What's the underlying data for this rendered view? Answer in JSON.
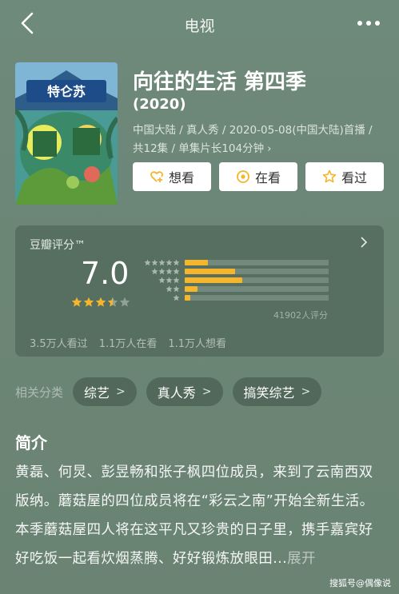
{
  "header": {
    "title": "电视"
  },
  "show": {
    "title": "向往的生活 第四季",
    "year": "(2020)",
    "meta": "中国大陆 / 真人秀 / 2020-05-08(中国大陆)首播 / 共12集 / 单集片长104分钟",
    "meta_chevron": "›",
    "poster_text": "特仑苏"
  },
  "actions": {
    "want": "想看",
    "watching": "在看",
    "watched": "看过"
  },
  "rating": {
    "label": "豆瓣评分™",
    "score": "7.0",
    "stars_value": 3.5,
    "distribution": [
      {
        "stars": 5,
        "fraction": 0.16
      },
      {
        "stars": 4,
        "fraction": 0.35
      },
      {
        "stars": 3,
        "fraction": 0.4
      },
      {
        "stars": 2,
        "fraction": 0.09
      },
      {
        "stars": 1,
        "fraction": 0.04
      }
    ],
    "count": "41902人评分",
    "stats": [
      "3.5万人看过",
      "1.1万人在看",
      "1.1万人想看"
    ],
    "star_color": "#f5b62b"
  },
  "categories": {
    "label": "相关分类",
    "tags": [
      "综艺",
      "真人秀",
      "搞笑综艺"
    ]
  },
  "intro": {
    "title": "简介",
    "text": "黄磊、何炅、彭昱畅和张子枫四位成员，来到了云南西双版纳。蘑菇屋的四位成员将在“彩云之南”开始全新生活。 本季蘑菇屋四人将在这平凡又珍贵的日子里，携手嘉宾好好吃饭一起看炊烟蒸腾、好好锻炼放眼田...",
    "expand": "展开"
  },
  "watermark": "搜狐号@偶像说"
}
